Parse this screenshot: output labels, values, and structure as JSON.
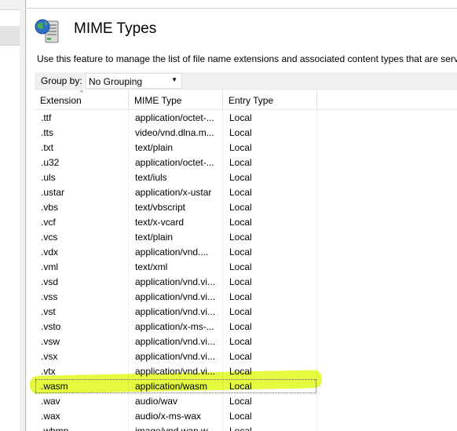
{
  "page": {
    "title": "MIME Types",
    "description": "Use this feature to manage the list of file name extensions and associated content types that are served"
  },
  "toolbar": {
    "group_by_label": "Group by:",
    "group_by_value": "No Grouping"
  },
  "columns": [
    "Extension",
    "MIME Type",
    "Entry Type"
  ],
  "rows": [
    {
      "ext": ".ttf",
      "mime": "application/octet-...",
      "entry": "Local"
    },
    {
      "ext": ".tts",
      "mime": "video/vnd.dlna.m...",
      "entry": "Local"
    },
    {
      "ext": ".txt",
      "mime": "text/plain",
      "entry": "Local"
    },
    {
      "ext": ".u32",
      "mime": "application/octet-...",
      "entry": "Local"
    },
    {
      "ext": ".uls",
      "mime": "text/iuls",
      "entry": "Local"
    },
    {
      "ext": ".ustar",
      "mime": "application/x-ustar",
      "entry": "Local"
    },
    {
      "ext": ".vbs",
      "mime": "text/vbscript",
      "entry": "Local"
    },
    {
      "ext": ".vcf",
      "mime": "text/x-vcard",
      "entry": "Local"
    },
    {
      "ext": ".vcs",
      "mime": "text/plain",
      "entry": "Local"
    },
    {
      "ext": ".vdx",
      "mime": "application/vnd....",
      "entry": "Local"
    },
    {
      "ext": ".vml",
      "mime": "text/xml",
      "entry": "Local"
    },
    {
      "ext": ".vsd",
      "mime": "application/vnd.vi...",
      "entry": "Local"
    },
    {
      "ext": ".vss",
      "mime": "application/vnd.vi...",
      "entry": "Local"
    },
    {
      "ext": ".vst",
      "mime": "application/vnd.vi...",
      "entry": "Local"
    },
    {
      "ext": ".vsto",
      "mime": "application/x-ms-...",
      "entry": "Local"
    },
    {
      "ext": ".vsw",
      "mime": "application/vnd.vi...",
      "entry": "Local"
    },
    {
      "ext": ".vsx",
      "mime": "application/vnd.vi...",
      "entry": "Local"
    },
    {
      "ext": ".vtx",
      "mime": "application/vnd.vi...",
      "entry": "Local"
    },
    {
      "ext": ".wasm",
      "mime": "application/wasm",
      "entry": "Local",
      "selected": true
    },
    {
      "ext": ".wav",
      "mime": "audio/wav",
      "entry": "Local"
    },
    {
      "ext": ".wax",
      "mime": "audio/x-ms-wax",
      "entry": "Local"
    },
    {
      "ext": ".wbmp",
      "mime": "image/vnd.wap.w...",
      "entry": "Local"
    }
  ],
  "colors": {
    "highlight": "#dcfa00",
    "toolbar_bg": "#f0f0f0",
    "globe_blue": "#2f6fc4"
  },
  "icons": {
    "title": "mime-types-server-icon",
    "sort": "sort-ascending-icon",
    "dropdown": "chevron-down-icon"
  }
}
